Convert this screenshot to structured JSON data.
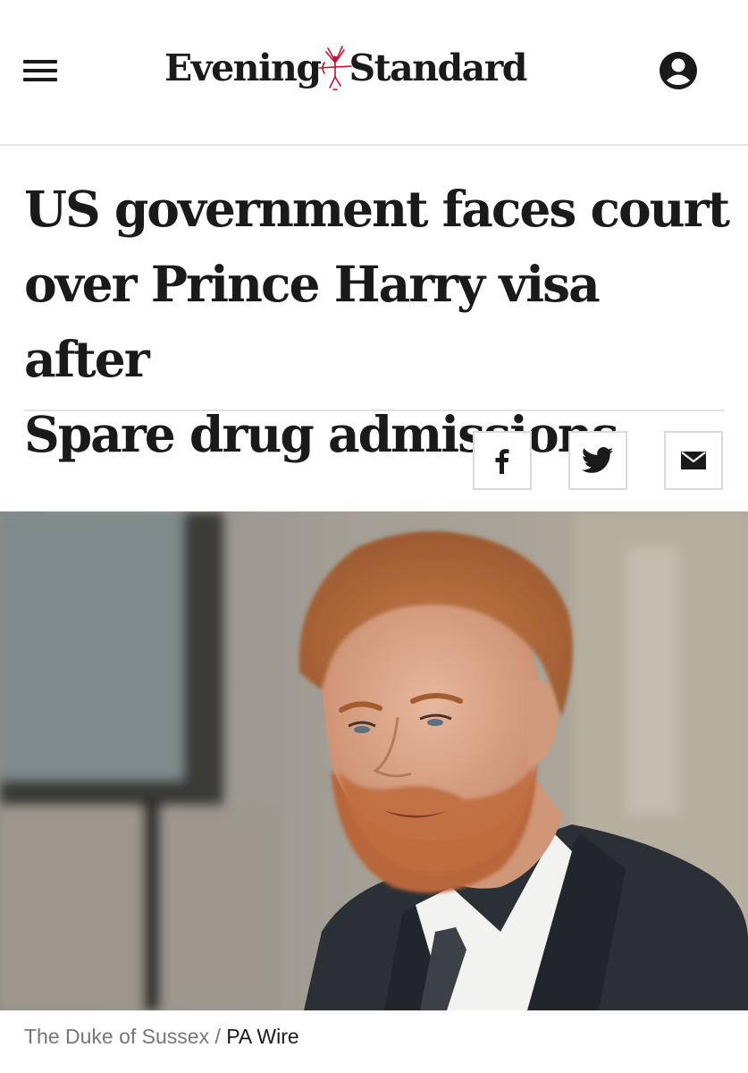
{
  "header": {
    "logo_left": "Evening",
    "logo_right": "Standard",
    "menu_icon": "hamburger-menu-icon",
    "account_icon": "user-account-icon"
  },
  "article": {
    "headline_lines": [
      "US government faces court",
      "over Prince Harry visa after",
      "Spare drug admissions"
    ],
    "share": {
      "facebook_icon": "facebook-icon",
      "twitter_icon": "twitter-icon",
      "email_icon": "email-icon"
    },
    "image": {
      "caption": "The Duke of Sussex",
      "separator": " / ",
      "credit": "PA Wire"
    }
  },
  "colors": {
    "text": "#1a1a1a",
    "logo_emblem": "#c8102e",
    "caption_gray": "#777777",
    "border": "#dadada"
  }
}
